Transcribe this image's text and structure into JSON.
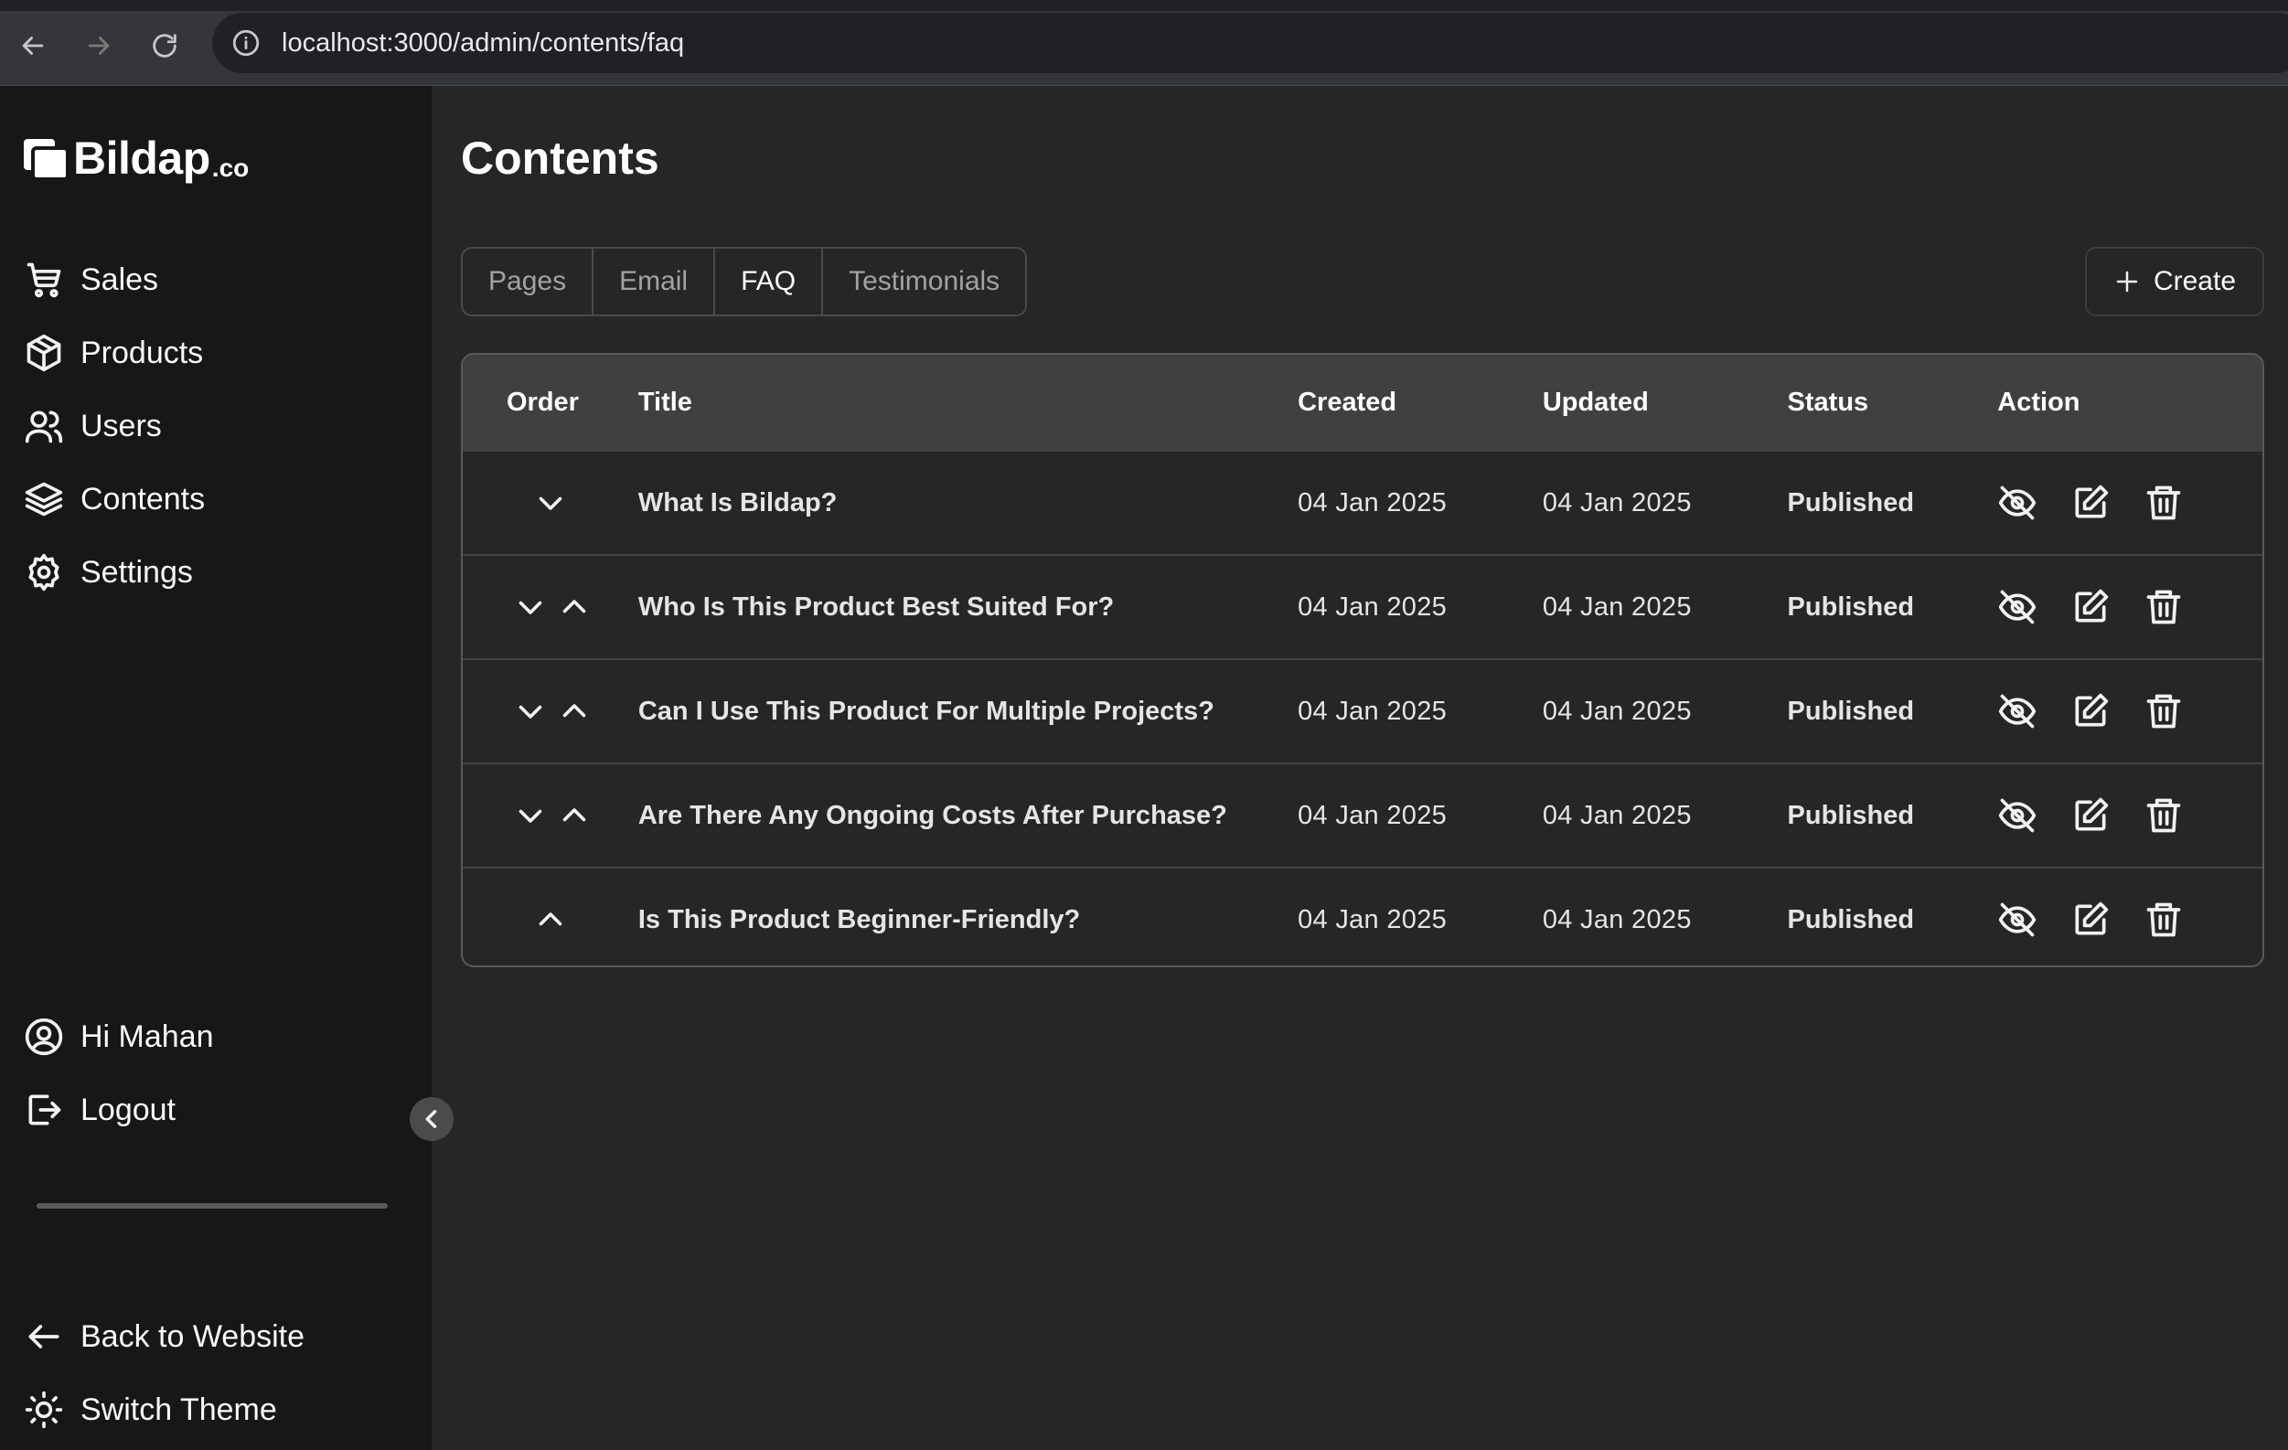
{
  "browser": {
    "url": "localhost:3000/admin/contents/faq"
  },
  "brand": {
    "name": "Bildap",
    "tld": ".co"
  },
  "sidebar": {
    "items": [
      {
        "label": "Sales",
        "icon": "cart-icon"
      },
      {
        "label": "Products",
        "icon": "box-icon"
      },
      {
        "label": "Users",
        "icon": "users-icon"
      },
      {
        "label": "Contents",
        "icon": "layers-icon"
      },
      {
        "label": "Settings",
        "icon": "gear-icon"
      }
    ],
    "account": [
      {
        "label": "Hi Mahan",
        "icon": "user-circle-icon"
      },
      {
        "label": "Logout",
        "icon": "logout-icon"
      }
    ],
    "footer": [
      {
        "label": "Back to Website",
        "icon": "arrow-left-icon"
      },
      {
        "label": "Switch Theme",
        "icon": "sun-icon"
      }
    ]
  },
  "main": {
    "title": "Contents",
    "tabs": [
      {
        "label": "Pages",
        "active": false
      },
      {
        "label": "Email",
        "active": false
      },
      {
        "label": "FAQ",
        "active": true
      },
      {
        "label": "Testimonials",
        "active": false
      }
    ],
    "create_label": "Create"
  },
  "table": {
    "headers": {
      "order": "Order",
      "title": "Title",
      "created": "Created",
      "updated": "Updated",
      "status": "Status",
      "action": "Action"
    },
    "rows": [
      {
        "title": "What Is Bildap?",
        "created": "04 Jan 2025",
        "updated": "04 Jan 2025",
        "status": "Published",
        "order_controls": [
          "down"
        ]
      },
      {
        "title": "Who Is This Product Best Suited For?",
        "created": "04 Jan 2025",
        "updated": "04 Jan 2025",
        "status": "Published",
        "order_controls": [
          "down",
          "up"
        ]
      },
      {
        "title": "Can I Use This Product For Multiple Projects?",
        "created": "04 Jan 2025",
        "updated": "04 Jan 2025",
        "status": "Published",
        "order_controls": [
          "down",
          "up"
        ]
      },
      {
        "title": "Are There Any Ongoing Costs After Purchase?",
        "created": "04 Jan 2025",
        "updated": "04 Jan 2025",
        "status": "Published",
        "order_controls": [
          "down",
          "up"
        ]
      },
      {
        "title": "Is This Product Beginner-Friendly?",
        "created": "04 Jan 2025",
        "updated": "04 Jan 2025",
        "status": "Published",
        "order_controls": [
          "up"
        ]
      }
    ]
  }
}
